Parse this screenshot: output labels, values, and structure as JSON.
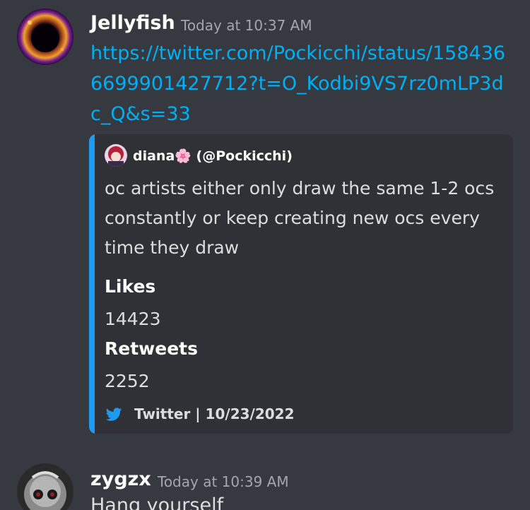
{
  "messages": [
    {
      "author": "Jellyfish",
      "timestamp": "Today at 10:37 AM",
      "link": "https://twitter.com/Pockicchi/status/1584366699901427712?t=O_Kodbi9VS7rz0mLP3dc_Q&s=33",
      "embed": {
        "author": "diana🌸 (@Pockicchi)",
        "description": "oc artists either only draw the same 1-2 ocs constantly or keep creating new ocs every time they draw",
        "fields": [
          {
            "name": "Likes",
            "value": "14423"
          },
          {
            "name": "Retweets",
            "value": "2252"
          }
        ],
        "footer": "Twitter | 10/23/2022",
        "accent_color": "#1d9bf0"
      }
    },
    {
      "author": "zygzx",
      "timestamp": "Today at 10:39 AM",
      "content": "Hang yourself"
    }
  ],
  "colors": {
    "background": "#36393f",
    "embed_background": "#2f3136",
    "link": "#00aff4",
    "timestamp": "#a3a6aa",
    "text": "#dcddde"
  }
}
